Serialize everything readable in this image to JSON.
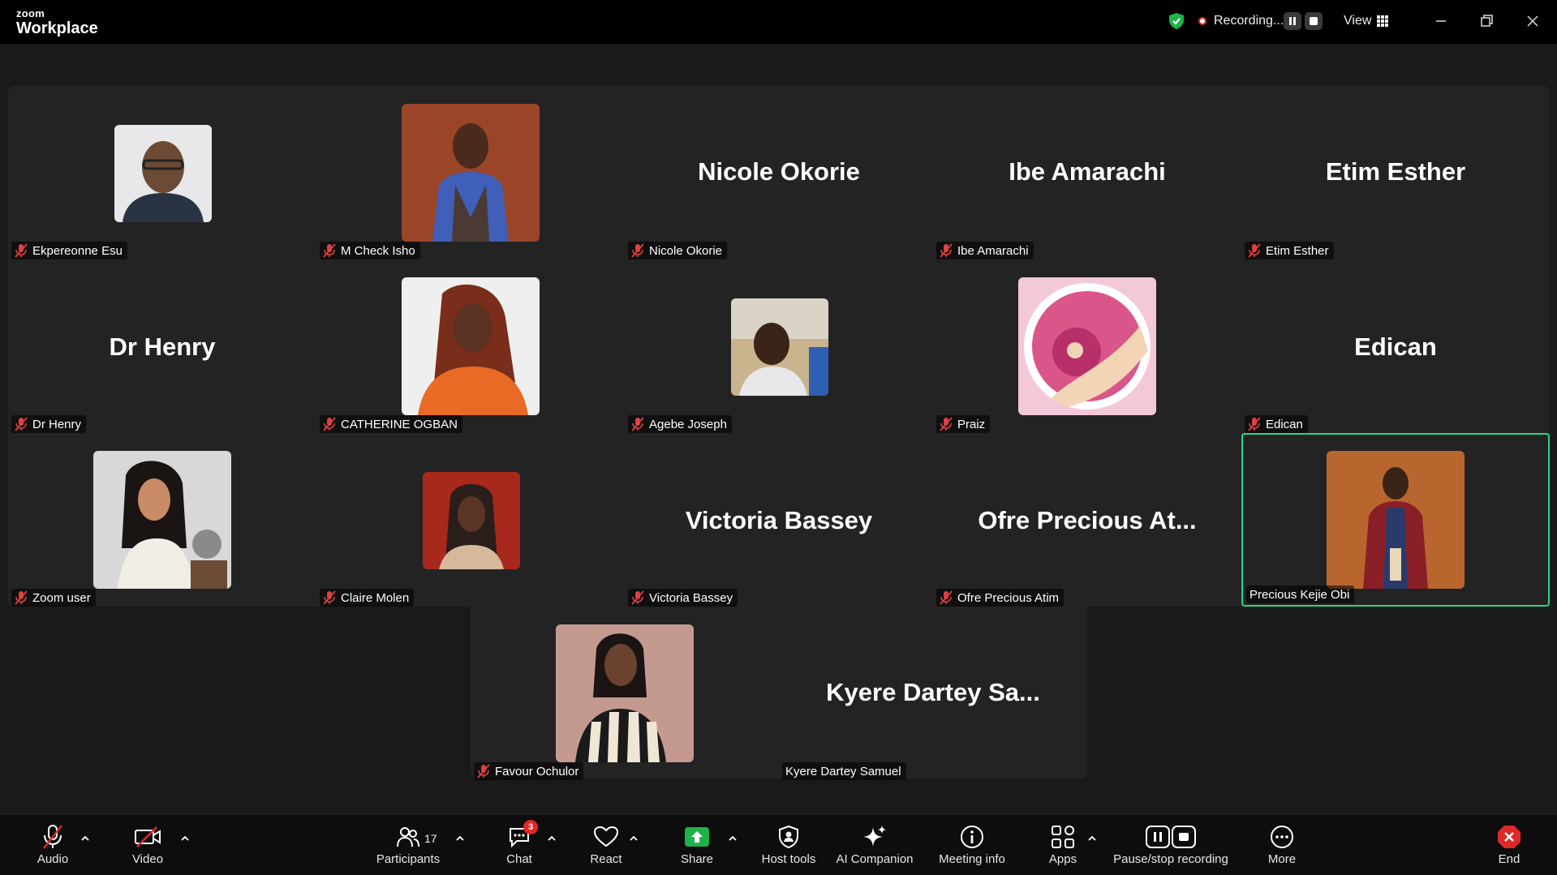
{
  "app": {
    "brand_small": "zoom",
    "brand_big": "Workplace"
  },
  "titlebar": {
    "recording_label": "Recording...",
    "view_label": "View"
  },
  "participants_grid": [
    {
      "name": "Ekpereonne Esu",
      "display": "photo",
      "muted": true
    },
    {
      "name": "M Check Isho",
      "display": "photo",
      "muted": true
    },
    {
      "name": "Nicole Okorie",
      "display": "name",
      "big_label": "Nicole Okorie",
      "muted": true
    },
    {
      "name": "Ibe Amarachi",
      "display": "name",
      "big_label": "Ibe Amarachi",
      "muted": true
    },
    {
      "name": "Etim Esther",
      "display": "name",
      "big_label": "Etim Esther",
      "muted": true
    },
    {
      "name": "Dr Henry",
      "display": "name",
      "big_label": "Dr Henry",
      "muted": true
    },
    {
      "name": "CATHERINE OGBAN",
      "display": "photo",
      "muted": true
    },
    {
      "name": "Agebe Joseph",
      "display": "photo",
      "muted": true
    },
    {
      "name": "Praiz",
      "display": "photo",
      "muted": true
    },
    {
      "name": "Edican",
      "display": "name",
      "big_label": "Edican",
      "muted": true
    },
    {
      "name": "Zoom user",
      "display": "photo",
      "muted": true
    },
    {
      "name": "Claire Molen",
      "display": "photo",
      "muted": true
    },
    {
      "name": "Victoria Bassey",
      "display": "name",
      "big_label": "Victoria Bassey",
      "muted": true
    },
    {
      "name": "Ofre Precious Atim",
      "display": "name",
      "big_label": "Ofre Precious At...",
      "muted": true
    },
    {
      "name": "Precious Kejie Obi",
      "display": "photo",
      "muted": false,
      "active_speaker": true
    },
    {
      "name": "Favour Ochulor",
      "display": "photo",
      "muted": true
    },
    {
      "name": "Kyere Dartey Samuel",
      "display": "name",
      "big_label": "Kyere Dartey Sa...",
      "muted": false
    }
  ],
  "toolbar": {
    "audio": "Audio",
    "video": "Video",
    "participants": "Participants",
    "participants_count": "17",
    "chat": "Chat",
    "chat_badge": "3",
    "react": "React",
    "share": "Share",
    "host_tools": "Host tools",
    "ai_companion": "AI Companion",
    "meeting_info": "Meeting info",
    "apps": "Apps",
    "pause_stop_recording": "Pause/stop recording",
    "more": "More",
    "end": "End"
  },
  "colors": {
    "accent_green": "#24d58e",
    "share_green": "#1fb24a",
    "recording_red": "#e02828",
    "end_red": "#e02828",
    "shield_green": "#1fb24a"
  }
}
